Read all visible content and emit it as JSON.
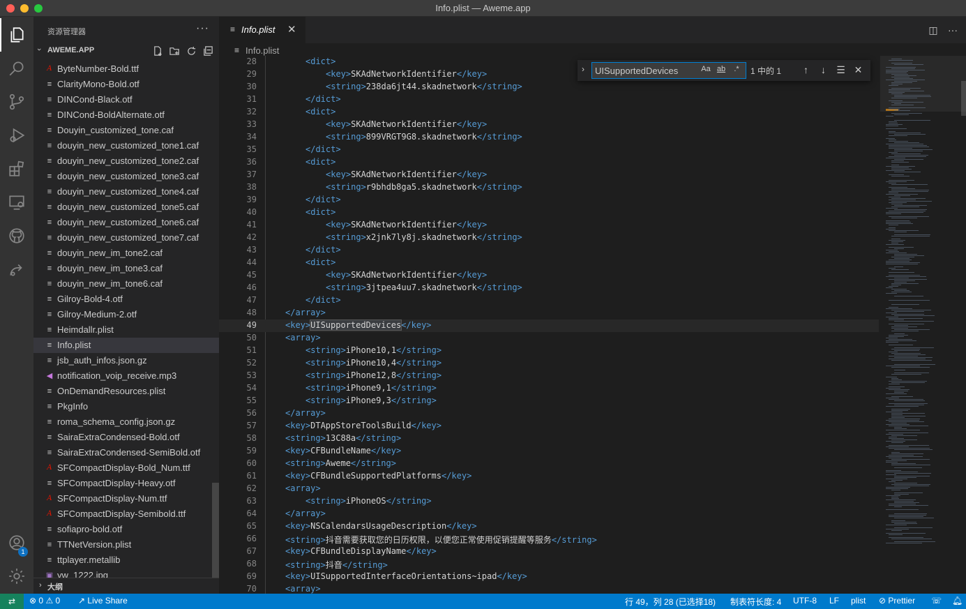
{
  "window": {
    "title": "Info.plist — Aweme.app"
  },
  "activity_bar": {
    "items": [
      "explorer",
      "search",
      "source-control",
      "run-debug",
      "extensions",
      "remote-explorer",
      "github",
      "live-share"
    ],
    "account_badge": "1"
  },
  "sidebar": {
    "title": "资源管理器",
    "section": "AWEME.APP",
    "files": [
      {
        "name": "ByteNumber-Bold.ttf",
        "icon": "font"
      },
      {
        "name": "ClarityMono-Bold.otf",
        "icon": "plain"
      },
      {
        "name": "DINCond-Black.otf",
        "icon": "plain"
      },
      {
        "name": "DINCond-BoldAlternate.otf",
        "icon": "plain"
      },
      {
        "name": "Douyin_customized_tone.caf",
        "icon": "plain"
      },
      {
        "name": "douyin_new_customized_tone1.caf",
        "icon": "plain"
      },
      {
        "name": "douyin_new_customized_tone2.caf",
        "icon": "plain"
      },
      {
        "name": "douyin_new_customized_tone3.caf",
        "icon": "plain"
      },
      {
        "name": "douyin_new_customized_tone4.caf",
        "icon": "plain"
      },
      {
        "name": "douyin_new_customized_tone5.caf",
        "icon": "plain"
      },
      {
        "name": "douyin_new_customized_tone6.caf",
        "icon": "plain"
      },
      {
        "name": "douyin_new_customized_tone7.caf",
        "icon": "plain"
      },
      {
        "name": "douyin_new_im_tone2.caf",
        "icon": "plain"
      },
      {
        "name": "douyin_new_im_tone3.caf",
        "icon": "plain"
      },
      {
        "name": "douyin_new_im_tone6.caf",
        "icon": "plain"
      },
      {
        "name": "Gilroy-Bold-4.otf",
        "icon": "plain"
      },
      {
        "name": "Gilroy-Medium-2.otf",
        "icon": "plain"
      },
      {
        "name": "Heimdallr.plist",
        "icon": "plain"
      },
      {
        "name": "Info.plist",
        "icon": "plain",
        "selected": true
      },
      {
        "name": "jsb_auth_infos.json.gz",
        "icon": "plain"
      },
      {
        "name": "notification_voip_receive.mp3",
        "icon": "audio"
      },
      {
        "name": "OnDemandResources.plist",
        "icon": "plain"
      },
      {
        "name": "PkgInfo",
        "icon": "plain"
      },
      {
        "name": "roma_schema_config.json.gz",
        "icon": "plain"
      },
      {
        "name": "SairaExtraCondensed-Bold.otf",
        "icon": "plain"
      },
      {
        "name": "SairaExtraCondensed-SemiBold.otf",
        "icon": "plain"
      },
      {
        "name": "SFCompactDisplay-Bold_Num.ttf",
        "icon": "font"
      },
      {
        "name": "SFCompactDisplay-Heavy.otf",
        "icon": "plain"
      },
      {
        "name": "SFCompactDisplay-Num.ttf",
        "icon": "font"
      },
      {
        "name": "SFCompactDisplay-Semibold.ttf",
        "icon": "font"
      },
      {
        "name": "sofiapro-bold.otf",
        "icon": "plain"
      },
      {
        "name": "TTNetVersion.plist",
        "icon": "plain"
      },
      {
        "name": "ttplayer.metallib",
        "icon": "plain"
      },
      {
        "name": "yw_1222.jpg",
        "icon": "img"
      }
    ],
    "outline_label": "大纲"
  },
  "tab": {
    "name": "Info.plist"
  },
  "breadcrumb": "Info.plist",
  "find": {
    "query": "UISupportedDevices",
    "opt_case": "Aa",
    "opt_word": "ab",
    "opt_regex": ".*",
    "count": "1 中的 1"
  },
  "editor": {
    "current_line": 49,
    "lines": [
      {
        "n": "28",
        "indent": 1,
        "parts": [
          [
            "t",
            "<dict>"
          ]
        ]
      },
      {
        "n": "29",
        "indent": 2,
        "parts": [
          [
            "t",
            "<key>"
          ],
          [
            "x",
            "SKAdNetworkIdentifier"
          ],
          [
            "t",
            "</key>"
          ]
        ]
      },
      {
        "n": "30",
        "indent": 2,
        "parts": [
          [
            "t",
            "<string>"
          ],
          [
            "x",
            "238da6jt44.skadnetwork"
          ],
          [
            "t",
            "</string>"
          ]
        ]
      },
      {
        "n": "31",
        "indent": 1,
        "parts": [
          [
            "t",
            "</dict>"
          ]
        ]
      },
      {
        "n": "32",
        "indent": 1,
        "parts": [
          [
            "t",
            "<dict>"
          ]
        ]
      },
      {
        "n": "33",
        "indent": 2,
        "parts": [
          [
            "t",
            "<key>"
          ],
          [
            "x",
            "SKAdNetworkIdentifier"
          ],
          [
            "t",
            "</key>"
          ]
        ]
      },
      {
        "n": "34",
        "indent": 2,
        "parts": [
          [
            "t",
            "<string>"
          ],
          [
            "x",
            "899VRGT9G8.skadnetwork"
          ],
          [
            "t",
            "</string>"
          ]
        ]
      },
      {
        "n": "35",
        "indent": 1,
        "parts": [
          [
            "t",
            "</dict>"
          ]
        ]
      },
      {
        "n": "36",
        "indent": 1,
        "parts": [
          [
            "t",
            "<dict>"
          ]
        ]
      },
      {
        "n": "37",
        "indent": 2,
        "parts": [
          [
            "t",
            "<key>"
          ],
          [
            "x",
            "SKAdNetworkIdentifier"
          ],
          [
            "t",
            "</key>"
          ]
        ]
      },
      {
        "n": "38",
        "indent": 2,
        "parts": [
          [
            "t",
            "<string>"
          ],
          [
            "x",
            "r9bhdb8ga5.skadnetwork"
          ],
          [
            "t",
            "</string>"
          ]
        ]
      },
      {
        "n": "39",
        "indent": 1,
        "parts": [
          [
            "t",
            "</dict>"
          ]
        ]
      },
      {
        "n": "40",
        "indent": 1,
        "parts": [
          [
            "t",
            "<dict>"
          ]
        ]
      },
      {
        "n": "41",
        "indent": 2,
        "parts": [
          [
            "t",
            "<key>"
          ],
          [
            "x",
            "SKAdNetworkIdentifier"
          ],
          [
            "t",
            "</key>"
          ]
        ]
      },
      {
        "n": "42",
        "indent": 2,
        "parts": [
          [
            "t",
            "<string>"
          ],
          [
            "x",
            "x2jnk7ly8j.skadnetwork"
          ],
          [
            "t",
            "</string>"
          ]
        ]
      },
      {
        "n": "43",
        "indent": 1,
        "parts": [
          [
            "t",
            "</dict>"
          ]
        ]
      },
      {
        "n": "44",
        "indent": 1,
        "parts": [
          [
            "t",
            "<dict>"
          ]
        ]
      },
      {
        "n": "45",
        "indent": 2,
        "parts": [
          [
            "t",
            "<key>"
          ],
          [
            "x",
            "SKAdNetworkIdentifier"
          ],
          [
            "t",
            "</key>"
          ]
        ]
      },
      {
        "n": "46",
        "indent": 2,
        "parts": [
          [
            "t",
            "<string>"
          ],
          [
            "x",
            "3jtpea4uu7.skadnetwork"
          ],
          [
            "t",
            "</string>"
          ]
        ]
      },
      {
        "n": "47",
        "indent": 1,
        "parts": [
          [
            "t",
            "</dict>"
          ]
        ]
      },
      {
        "n": "48",
        "indent": 0,
        "parts": [
          [
            "t",
            "</array>"
          ]
        ]
      },
      {
        "n": "49",
        "indent": 0,
        "parts": [
          [
            "t",
            "<key>"
          ],
          [
            "h",
            "UISupportedDevices"
          ],
          [
            "t",
            "</key>"
          ]
        ]
      },
      {
        "n": "50",
        "indent": 0,
        "parts": [
          [
            "t",
            "<array>"
          ]
        ]
      },
      {
        "n": "51",
        "indent": 1,
        "parts": [
          [
            "t",
            "<string>"
          ],
          [
            "x",
            "iPhone10,1"
          ],
          [
            "t",
            "</string>"
          ]
        ]
      },
      {
        "n": "52",
        "indent": 1,
        "parts": [
          [
            "t",
            "<string>"
          ],
          [
            "x",
            "iPhone10,4"
          ],
          [
            "t",
            "</string>"
          ]
        ]
      },
      {
        "n": "53",
        "indent": 1,
        "parts": [
          [
            "t",
            "<string>"
          ],
          [
            "x",
            "iPhone12,8"
          ],
          [
            "t",
            "</string>"
          ]
        ]
      },
      {
        "n": "54",
        "indent": 1,
        "parts": [
          [
            "t",
            "<string>"
          ],
          [
            "x",
            "iPhone9,1"
          ],
          [
            "t",
            "</string>"
          ]
        ]
      },
      {
        "n": "55",
        "indent": 1,
        "parts": [
          [
            "t",
            "<string>"
          ],
          [
            "x",
            "iPhone9,3"
          ],
          [
            "t",
            "</string>"
          ]
        ]
      },
      {
        "n": "56",
        "indent": 0,
        "parts": [
          [
            "t",
            "</array>"
          ]
        ]
      },
      {
        "n": "57",
        "indent": 0,
        "parts": [
          [
            "t",
            "<key>"
          ],
          [
            "x",
            "DTAppStoreToolsBuild"
          ],
          [
            "t",
            "</key>"
          ]
        ]
      },
      {
        "n": "58",
        "indent": 0,
        "parts": [
          [
            "t",
            "<string>"
          ],
          [
            "x",
            "13C88a"
          ],
          [
            "t",
            "</string>"
          ]
        ]
      },
      {
        "n": "59",
        "indent": 0,
        "parts": [
          [
            "t",
            "<key>"
          ],
          [
            "x",
            "CFBundleName"
          ],
          [
            "t",
            "</key>"
          ]
        ]
      },
      {
        "n": "60",
        "indent": 0,
        "parts": [
          [
            "t",
            "<string>"
          ],
          [
            "x",
            "Aweme"
          ],
          [
            "t",
            "</string>"
          ]
        ]
      },
      {
        "n": "61",
        "indent": 0,
        "parts": [
          [
            "t",
            "<key>"
          ],
          [
            "x",
            "CFBundleSupportedPlatforms"
          ],
          [
            "t",
            "</key>"
          ]
        ]
      },
      {
        "n": "62",
        "indent": 0,
        "parts": [
          [
            "t",
            "<array>"
          ]
        ]
      },
      {
        "n": "63",
        "indent": 1,
        "parts": [
          [
            "t",
            "<string>"
          ],
          [
            "x",
            "iPhoneOS"
          ],
          [
            "t",
            "</string>"
          ]
        ]
      },
      {
        "n": "64",
        "indent": 0,
        "parts": [
          [
            "t",
            "</array>"
          ]
        ]
      },
      {
        "n": "65",
        "indent": 0,
        "parts": [
          [
            "t",
            "<key>"
          ],
          [
            "x",
            "NSCalendarsUsageDescription"
          ],
          [
            "t",
            "</key>"
          ]
        ]
      },
      {
        "n": "66",
        "indent": 0,
        "parts": [
          [
            "t",
            "<string>"
          ],
          [
            "x",
            "抖音需要获取您的日历权限，以便您正常使用促销提醒等服务"
          ],
          [
            "t",
            "</string>"
          ]
        ]
      },
      {
        "n": "67",
        "indent": 0,
        "parts": [
          [
            "t",
            "<key>"
          ],
          [
            "x",
            "CFBundleDisplayName"
          ],
          [
            "t",
            "</key>"
          ]
        ]
      },
      {
        "n": "68",
        "indent": 0,
        "parts": [
          [
            "t",
            "<string>"
          ],
          [
            "x",
            "抖音"
          ],
          [
            "t",
            "</string>"
          ]
        ]
      },
      {
        "n": "69",
        "indent": 0,
        "parts": [
          [
            "t",
            "<key>"
          ],
          [
            "x",
            "UISupportedInterfaceOrientations~ipad"
          ],
          [
            "t",
            "</key>"
          ]
        ]
      },
      {
        "n": "70",
        "indent": 0,
        "parts": [
          [
            "t",
            "<array>"
          ]
        ]
      }
    ]
  },
  "statusbar": {
    "errors": "0",
    "warnings": "0",
    "live_share": "Live Share",
    "position": "行 49，列 28 (已选择18)",
    "tab_size": "制表符长度: 4",
    "encoding": "UTF-8",
    "eol": "LF",
    "language": "plist",
    "prettier": "Prettier"
  }
}
